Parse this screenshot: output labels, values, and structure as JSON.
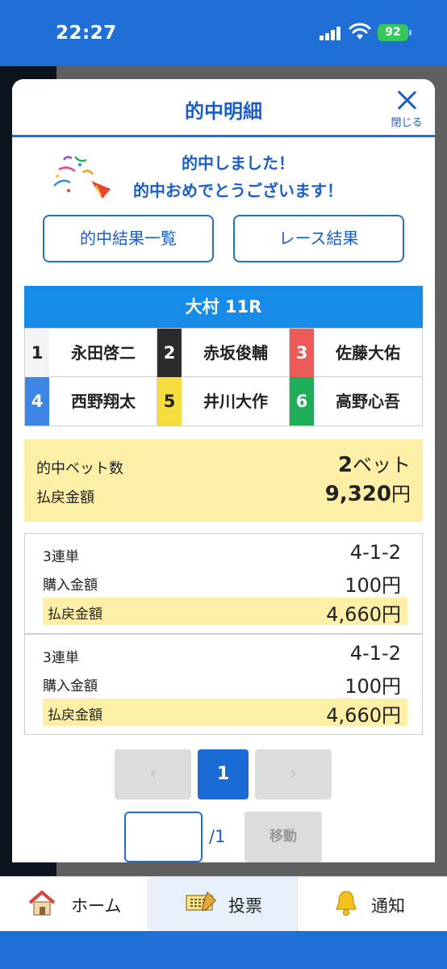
{
  "status_bar": {
    "time": "22:27",
    "battery": "92"
  },
  "modal": {
    "title": "的中明細",
    "close_label": "閉じる",
    "congrats_line1": "的中しました！",
    "congrats_line2": "的中おめでとうございます！",
    "buttons": {
      "hit_list": "的中結果一覧",
      "race_result": "レース結果"
    }
  },
  "race": {
    "header": "大村 11R",
    "racers": [
      {
        "num": "1",
        "name": "永田啓二",
        "bg": "#f3f3f3",
        "fg": "#222222"
      },
      {
        "num": "2",
        "name": "赤坂俊輔",
        "bg": "#2b2b2b",
        "fg": "#ffffff"
      },
      {
        "num": "3",
        "name": "佐藤大佑",
        "bg": "#ec5a5a",
        "fg": "#ffffff"
      },
      {
        "num": "4",
        "name": "西野翔太",
        "bg": "#3d86e6",
        "fg": "#ffffff"
      },
      {
        "num": "5",
        "name": "井川大作",
        "bg": "#f6dd3f",
        "fg": "#222222"
      },
      {
        "num": "6",
        "name": "高野心吾",
        "bg": "#1fad5a",
        "fg": "#ffffff"
      }
    ]
  },
  "summary": {
    "hit_count_label": "的中ベット数",
    "hit_count_value": "2",
    "hit_count_unit": "ベット",
    "payout_label": "払戻金額",
    "payout_value": "9,320",
    "payout_unit": "円"
  },
  "bets": [
    {
      "type": "3連単",
      "combo": "4-1-2",
      "purchase_label": "購入金額",
      "purchase": "100円",
      "payout_label": "払戻金額",
      "payout": "4,660円"
    },
    {
      "type": "3連単",
      "combo": "4-1-2",
      "purchase_label": "購入金額",
      "purchase": "100円",
      "payout_label": "払戻金額",
      "payout": "4,660円"
    }
  ],
  "pagination": {
    "prev": "‹",
    "current": "1",
    "next": "›",
    "total": "/1",
    "move_label": "移動",
    "input_value": ""
  },
  "nav": {
    "home": "ホーム",
    "vote": "投票",
    "notify": "通知"
  },
  "colors": {
    "brand": "#1f6fd6",
    "highlight": "#fdf0a6",
    "race_header": "#168ce8"
  }
}
